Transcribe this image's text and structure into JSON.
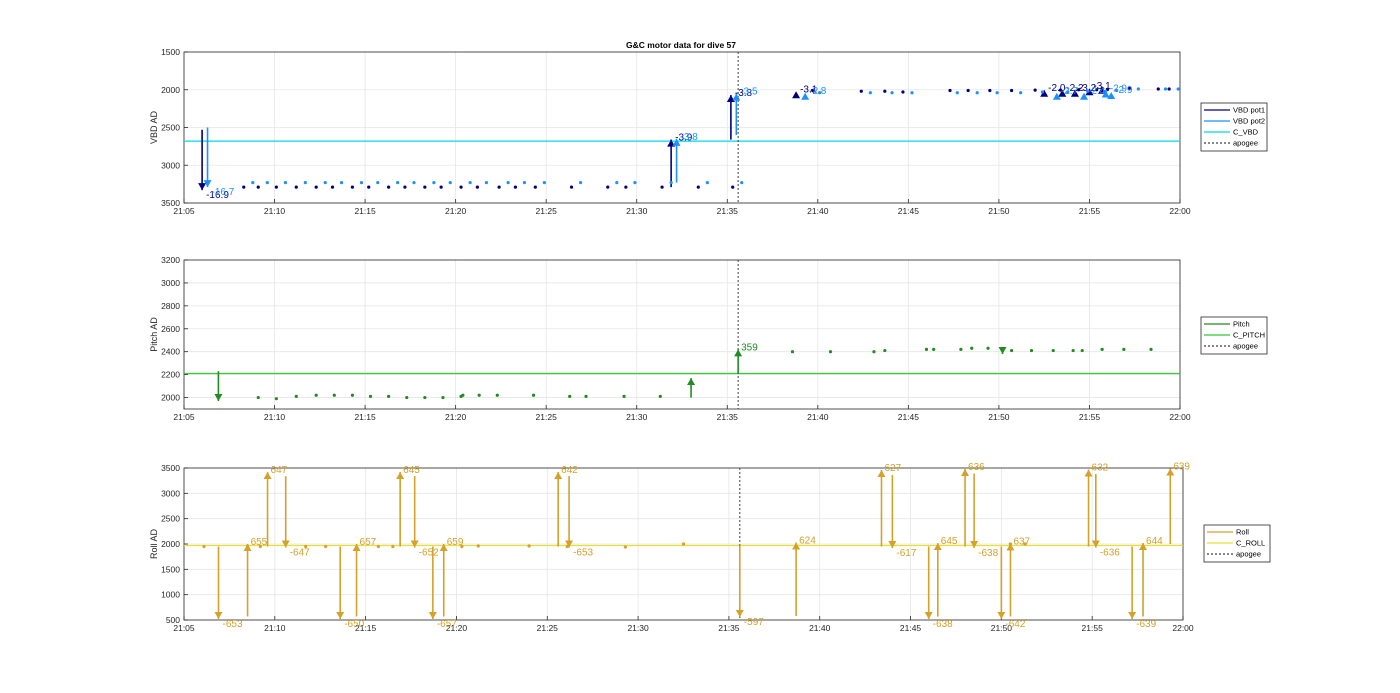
{
  "colors": {
    "vbd1": "#00007f",
    "vbd2": "#1e90ff",
    "cvbd": "#00d8e8",
    "pitch": "#228b22",
    "cpitch": "#33cc33",
    "roll": "#d4a12a",
    "croll": "#e8e030",
    "apogee": "#404040"
  },
  "chart_data": [
    {
      "type": "scatter",
      "title": "G&C motor data for dive 57",
      "ylabel": "VBD AD",
      "y_reversed": true,
      "ylim": [
        1500,
        3500
      ],
      "yticks": [
        1500,
        2000,
        2500,
        3000,
        3500
      ],
      "xlim": [
        0,
        55
      ],
      "xtick_labels": [
        "21:05",
        "21:10",
        "21:15",
        "21:20",
        "21:25",
        "21:30",
        "21:35",
        "21:40",
        "21:45",
        "21:50",
        "21:55",
        "22:00"
      ],
      "apogee_min": 30.6,
      "legend": [
        "VBD pot1",
        "VBD pot2",
        "C_VBD",
        "apogee"
      ],
      "legend_position": "right",
      "reference_line": 2680,
      "series": [
        {
          "name": "VBD pot1",
          "color_key": "vbd1",
          "dots": [
            [
              3.3,
              3290
            ],
            [
              4.1,
              3290
            ],
            [
              5.1,
              3290
            ],
            [
              6.2,
              3290
            ],
            [
              7.3,
              3290
            ],
            [
              8.2,
              3290
            ],
            [
              9.3,
              3290
            ],
            [
              10.2,
              3290
            ],
            [
              11.3,
              3290
            ],
            [
              12.2,
              3290
            ],
            [
              13.3,
              3290
            ],
            [
              14.2,
              3290
            ],
            [
              15.3,
              3290
            ],
            [
              16.2,
              3290
            ],
            [
              17.4,
              3290
            ],
            [
              18.3,
              3290
            ],
            [
              19.4,
              3290
            ],
            [
              21.4,
              3290
            ],
            [
              23.4,
              3290
            ],
            [
              24.4,
              3290
            ],
            [
              26.4,
              3290
            ],
            [
              28.4,
              3290
            ],
            [
              30.3,
              3290
            ],
            [
              34.7,
              2010
            ],
            [
              37.4,
              2020
            ],
            [
              38.7,
              2020
            ],
            [
              39.7,
              2030
            ],
            [
              42.3,
              2010
            ],
            [
              43.3,
              2010
            ],
            [
              44.5,
              2010
            ],
            [
              45.7,
              2010
            ],
            [
              47.0,
              2005
            ],
            [
              48.4,
              2005
            ],
            [
              49.4,
              2000
            ],
            [
              50.4,
              2000
            ],
            [
              51.0,
              1995
            ],
            [
              52.2,
              1980
            ],
            [
              53.8,
              1990
            ],
            [
              54.4,
              1990
            ]
          ],
          "arrows": [
            [
              1.0,
              2530,
              3330,
              "-16.9"
            ],
            [
              26.9,
              3290,
              2660,
              "-3.9"
            ],
            [
              30.2,
              2660,
              2070,
              "-3.8"
            ],
            [
              33.8,
              2020,
              2020,
              "-3.1"
            ],
            [
              47.5,
              2000,
              2000,
              "-2.0"
            ],
            [
              48.5,
              2000,
              2000,
              "-2.2"
            ],
            [
              49.2,
              2000,
              2000,
              "-3.2"
            ],
            [
              50.0,
              1980,
              1980,
              "-3.1"
            ],
            [
              50.7,
              1970,
              1960,
              ""
            ]
          ]
        },
        {
          "name": "VBD pot2",
          "color_key": "vbd2",
          "dots": [
            [
              3.8,
              3230
            ],
            [
              4.6,
              3230
            ],
            [
              5.6,
              3230
            ],
            [
              6.7,
              3230
            ],
            [
              7.8,
              3230
            ],
            [
              8.7,
              3230
            ],
            [
              9.8,
              3230
            ],
            [
              10.7,
              3230
            ],
            [
              11.8,
              3230
            ],
            [
              12.7,
              3230
            ],
            [
              13.8,
              3230
            ],
            [
              14.7,
              3230
            ],
            [
              15.8,
              3230
            ],
            [
              16.7,
              3230
            ],
            [
              17.9,
              3230
            ],
            [
              18.8,
              3230
            ],
            [
              19.9,
              3230
            ],
            [
              21.9,
              3230
            ],
            [
              23.9,
              3230
            ],
            [
              24.9,
              3230
            ],
            [
              26.9,
              3230
            ],
            [
              28.9,
              3230
            ],
            [
              30.8,
              3230
            ],
            [
              35.1,
              2040
            ],
            [
              37.9,
              2040
            ],
            [
              39.1,
              2040
            ],
            [
              40.2,
              2040
            ],
            [
              42.7,
              2040
            ],
            [
              43.8,
              2040
            ],
            [
              44.9,
              2040
            ],
            [
              46.2,
              2040
            ],
            [
              47.4,
              2030
            ],
            [
              48.8,
              2030
            ],
            [
              49.9,
              2020
            ],
            [
              50.9,
              2020
            ],
            [
              51.5,
              2010
            ],
            [
              52.7,
              1990
            ],
            [
              54.2,
              1990
            ],
            [
              54.9,
              1990
            ]
          ],
          "arrows": [
            [
              1.3,
              2500,
              3290,
              "-16.7"
            ],
            [
              27.2,
              3230,
              2650,
              "-3.8"
            ],
            [
              30.5,
              2600,
              2050,
              "-3.5"
            ],
            [
              34.3,
              2040,
              2040,
              "-2.8"
            ],
            [
              48.2,
              2040,
              2040,
              "-2.7"
            ],
            [
              49.7,
              2040,
              2040,
              "-2.4"
            ],
            [
              50.9,
              2010,
              2010,
              "-2.9"
            ],
            [
              51.2,
              2030,
              2030,
              "-2.9"
            ]
          ]
        }
      ]
    },
    {
      "type": "scatter",
      "ylabel": "Pitch AD",
      "ylim": [
        1900,
        3200
      ],
      "yticks": [
        2000,
        2200,
        2400,
        2600,
        2800,
        3000,
        3200
      ],
      "xlim": [
        0,
        55
      ],
      "xtick_labels": [
        "21:05",
        "21:10",
        "21:15",
        "21:20",
        "21:25",
        "21:30",
        "21:35",
        "21:40",
        "21:45",
        "21:50",
        "21:55",
        "22:00"
      ],
      "apogee_min": 30.6,
      "legend": [
        "Pitch",
        "C_PITCH",
        "apogee"
      ],
      "legend_position": "right",
      "reference_line": 2210,
      "series": [
        {
          "name": "Pitch",
          "color_key": "pitch",
          "dots": [
            [
              4.1,
              2000
            ],
            [
              5.1,
              1990
            ],
            [
              6.2,
              2010
            ],
            [
              7.3,
              2020
            ],
            [
              8.3,
              2020
            ],
            [
              9.3,
              2020
            ],
            [
              10.3,
              2010
            ],
            [
              11.3,
              2010
            ],
            [
              12.3,
              2000
            ],
            [
              13.3,
              2000
            ],
            [
              14.3,
              2000
            ],
            [
              15.3,
              2010
            ],
            [
              15.4,
              2020
            ],
            [
              16.3,
              2020
            ],
            [
              17.3,
              2020
            ],
            [
              19.3,
              2020
            ],
            [
              21.3,
              2010
            ],
            [
              22.2,
              2010
            ],
            [
              24.3,
              2010
            ],
            [
              26.3,
              2010
            ],
            [
              33.6,
              2400
            ],
            [
              35.7,
              2400
            ],
            [
              38.1,
              2400
            ],
            [
              38.7,
              2410
            ],
            [
              41.0,
              2420
            ],
            [
              41.4,
              2420
            ],
            [
              42.9,
              2420
            ],
            [
              43.5,
              2430
            ],
            [
              44.4,
              2430
            ],
            [
              45.7,
              2410
            ],
            [
              46.8,
              2410
            ],
            [
              48.0,
              2410
            ],
            [
              49.1,
              2410
            ],
            [
              49.6,
              2410
            ],
            [
              50.7,
              2420
            ],
            [
              51.9,
              2420
            ],
            [
              53.4,
              2420
            ]
          ],
          "arrows": [
            [
              1.9,
              2230,
              1970,
              ""
            ],
            [
              28.0,
              2000,
              2170,
              ""
            ],
            [
              30.6,
              2210,
              2420,
              "359"
            ],
            [
              45.2,
              2430,
              2380,
              ""
            ]
          ]
        }
      ]
    },
    {
      "type": "scatter",
      "ylabel": "Roll AD",
      "ylim": [
        500,
        3500
      ],
      "yticks": [
        500,
        1000,
        1500,
        2000,
        2500,
        3000,
        3500
      ],
      "xlim": [
        0,
        55
      ],
      "xtick_labels": [
        "21:05",
        "21:10",
        "21:15",
        "21:20",
        "21:25",
        "21:30",
        "21:35",
        "21:40",
        "21:45",
        "21:50",
        "21:55",
        "22:00"
      ],
      "apogee_min": 30.6,
      "legend": [
        "Roll",
        "C_ROLL",
        "apogee"
      ],
      "legend_position": "right",
      "reference_line": 1970,
      "series": [
        {
          "name": "Roll",
          "color_key": "roll",
          "dots": [
            [
              1.1,
              1950
            ],
            [
              3.5,
              1950
            ],
            [
              4.2,
              1950
            ],
            [
              6.7,
              1950
            ],
            [
              7.8,
              1950
            ],
            [
              10.7,
              1950
            ],
            [
              11.5,
              1950
            ],
            [
              15.3,
              1950
            ],
            [
              16.2,
              1960
            ],
            [
              19.0,
              1960
            ],
            [
              21.1,
              1950
            ],
            [
              24.3,
              1940
            ],
            [
              27.5,
              2000
            ],
            [
              33.7,
              1950
            ],
            [
              45.5,
              2000
            ],
            [
              46.3,
              2000
            ]
          ],
          "arrows": [
            [
              1.9,
              1950,
              520,
              "-653"
            ],
            [
              3.5,
              570,
              2000,
              "655"
            ],
            [
              4.6,
              1950,
              3420,
              "647"
            ],
            [
              5.6,
              3340,
              1930,
              "-647"
            ],
            [
              8.6,
              1950,
              520,
              "-650"
            ],
            [
              9.5,
              570,
              2000,
              "657"
            ],
            [
              11.9,
              1950,
              3420,
              "645"
            ],
            [
              12.7,
              3340,
              1930,
              "-652"
            ],
            [
              13.7,
              1950,
              520,
              "-657"
            ],
            [
              14.3,
              570,
              2000,
              "659"
            ],
            [
              20.6,
              1950,
              3420,
              "642"
            ],
            [
              21.2,
              3340,
              1930,
              "-653"
            ],
            [
              30.6,
              1970,
              560,
              "-597"
            ],
            [
              33.7,
              580,
              2030,
              "624"
            ],
            [
              38.4,
              1950,
              3460,
              "627"
            ],
            [
              39.0,
              3360,
              1920,
              "-617"
            ],
            [
              41.0,
              1950,
              520,
              "-638"
            ],
            [
              41.5,
              570,
              2020,
              "645"
            ],
            [
              43.0,
              1950,
              3480,
              "636"
            ],
            [
              43.5,
              3390,
              1920,
              "-638"
            ],
            [
              45.0,
              1950,
              520,
              "-642"
            ],
            [
              45.5,
              570,
              2010,
              "637"
            ],
            [
              49.8,
              1950,
              3470,
              "632"
            ],
            [
              50.2,
              3380,
              1930,
              "-636"
            ],
            [
              52.2,
              1950,
              520,
              "-639"
            ],
            [
              52.8,
              570,
              2020,
              "644"
            ],
            [
              54.3,
              2000,
              3490,
              "639"
            ]
          ]
        }
      ]
    }
  ]
}
